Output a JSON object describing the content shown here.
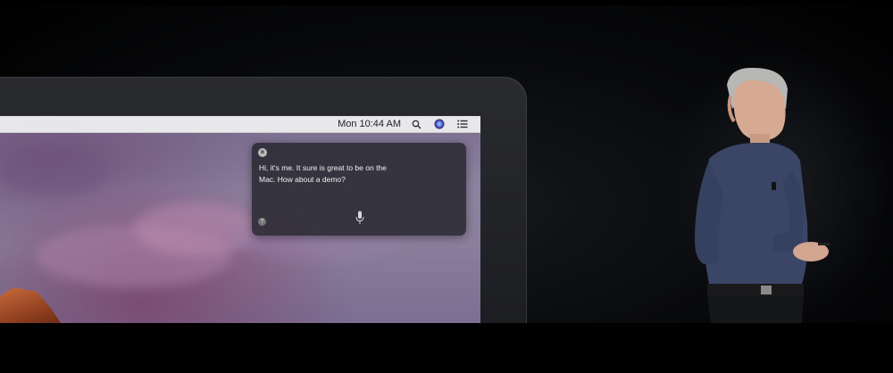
{
  "menubar": {
    "clock": "Mon 10:44 AM",
    "icons": [
      "search-icon",
      "siri-icon",
      "notification-center-icon"
    ]
  },
  "siri": {
    "message": "Hi, it's me. It sure is great to be on the Mac. How about a demo?",
    "close_icon": "close-icon",
    "help_icon": "help-icon",
    "mic_icon": "microphone-icon"
  },
  "colors": {
    "panel_bg": "#28282f",
    "menubar_bg": "#ececee",
    "stage_bg": "#000000"
  }
}
